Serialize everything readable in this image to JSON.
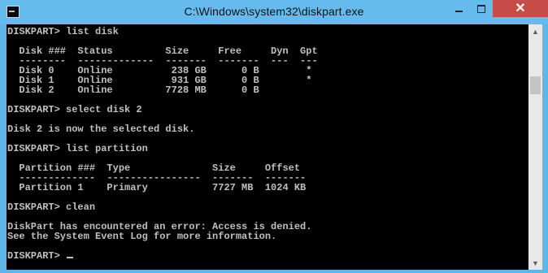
{
  "window": {
    "title": "C:\\Windows\\system32\\diskpart.exe",
    "icon": "console-icon",
    "controls": {
      "minimize": "minimize-icon",
      "maximize": "maximize-icon",
      "close": "✕"
    }
  },
  "console": {
    "lines": [
      "DISKPART> list disk",
      "",
      "  Disk ###  Status         Size     Free     Dyn  Gpt",
      "  --------  -------------  -------  -------  ---  ---",
      "  Disk 0    Online          238 GB      0 B        *",
      "  Disk 1    Online          931 GB      0 B        *",
      "  Disk 2    Online         7728 MB      0 B",
      "",
      "DISKPART> select disk 2",
      "",
      "Disk 2 is now the selected disk.",
      "",
      "DISKPART> list partition",
      "",
      "  Partition ###  Type              Size     Offset",
      "  -------------  ----------------  -------  -------",
      "  Partition 1    Primary           7727 MB  1024 KB",
      "",
      "DISKPART> clean",
      "",
      "DiskPart has encountered an error: Access is denied.",
      "See the System Event Log for more information.",
      "",
      "DISKPART> "
    ],
    "text_color": "#c0c0c0",
    "background_color": "#000000"
  },
  "scrollbar": {
    "up_icon": "▲",
    "down_icon": "▼"
  }
}
